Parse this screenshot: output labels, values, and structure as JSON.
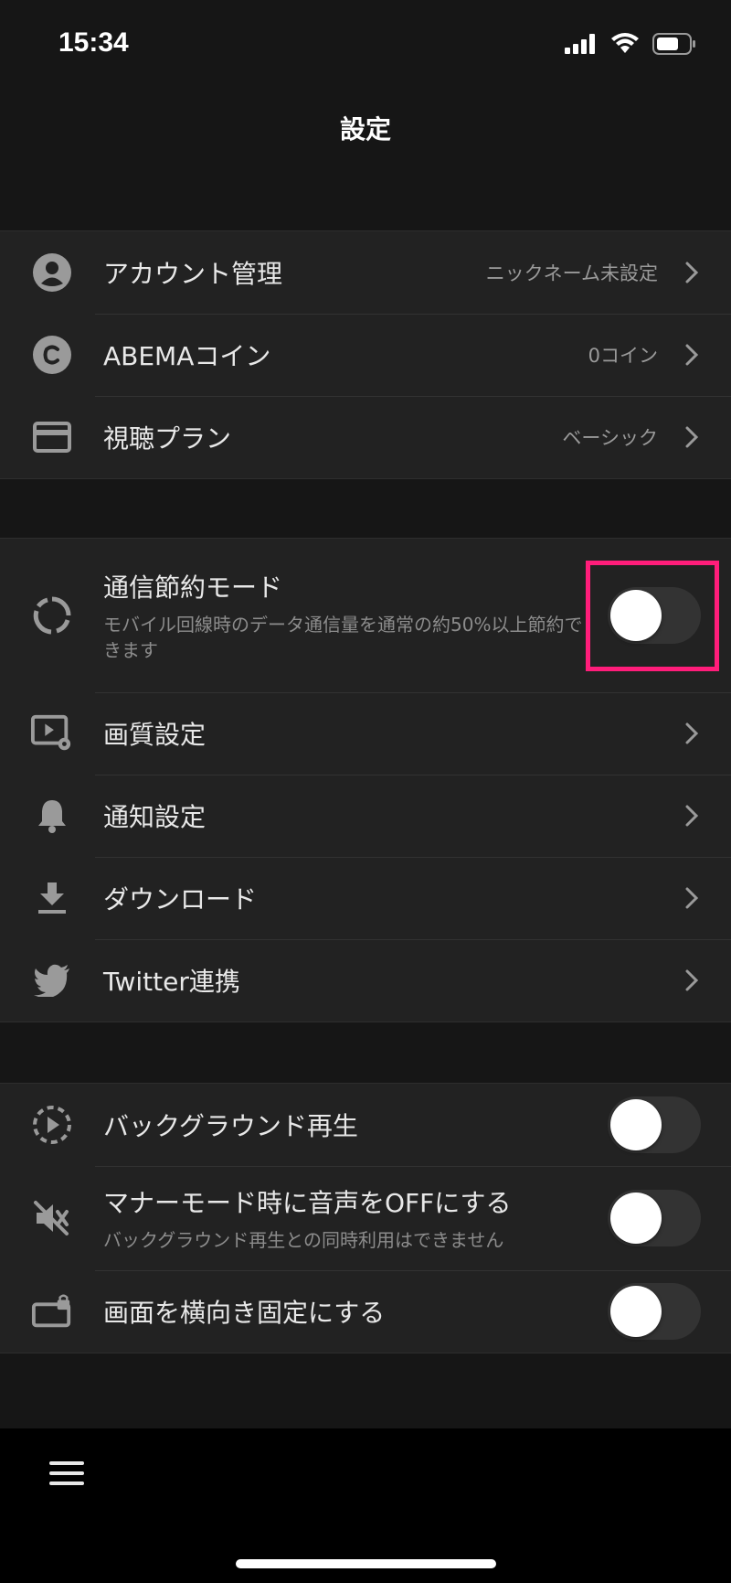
{
  "status": {
    "time": "15:34",
    "icons": [
      "signal-icon",
      "wifi-icon",
      "battery-icon"
    ]
  },
  "header": {
    "title": "設定"
  },
  "account_group": [
    {
      "label": "アカウント管理",
      "value": "ニックネーム未設定",
      "icon": "account-icon"
    },
    {
      "label": "ABEMAコイン",
      "value": "0コイン",
      "icon": "coin-icon"
    },
    {
      "label": "視聴プラン",
      "value": "ベーシック",
      "icon": "card-icon"
    }
  ],
  "settings_group": {
    "data_saver": {
      "label": "通信節約モード",
      "sub": "モバイル回線時のデータ通信量を通常の約50%以上節約できます",
      "enabled": false
    },
    "items": [
      {
        "label": "画質設定",
        "icon": "video-settings-icon"
      },
      {
        "label": "通知設定",
        "icon": "bell-icon"
      },
      {
        "label": "ダウンロード",
        "icon": "download-icon"
      },
      {
        "label": "Twitter連携",
        "icon": "twitter-icon"
      }
    ]
  },
  "playback_group": {
    "background": {
      "label": "バックグラウンド再生",
      "enabled": false
    },
    "manner": {
      "label": "マナーモード時に音声をOFFにする",
      "sub": "バックグラウンド再生との同時利用はできません",
      "enabled": false
    },
    "landscape": {
      "label": "画面を横向き固定にする",
      "enabled": false
    }
  },
  "colors": {
    "background": "#161616",
    "row": "#222222",
    "highlight": "#ff1d7a",
    "toggle_off": "#333333"
  }
}
